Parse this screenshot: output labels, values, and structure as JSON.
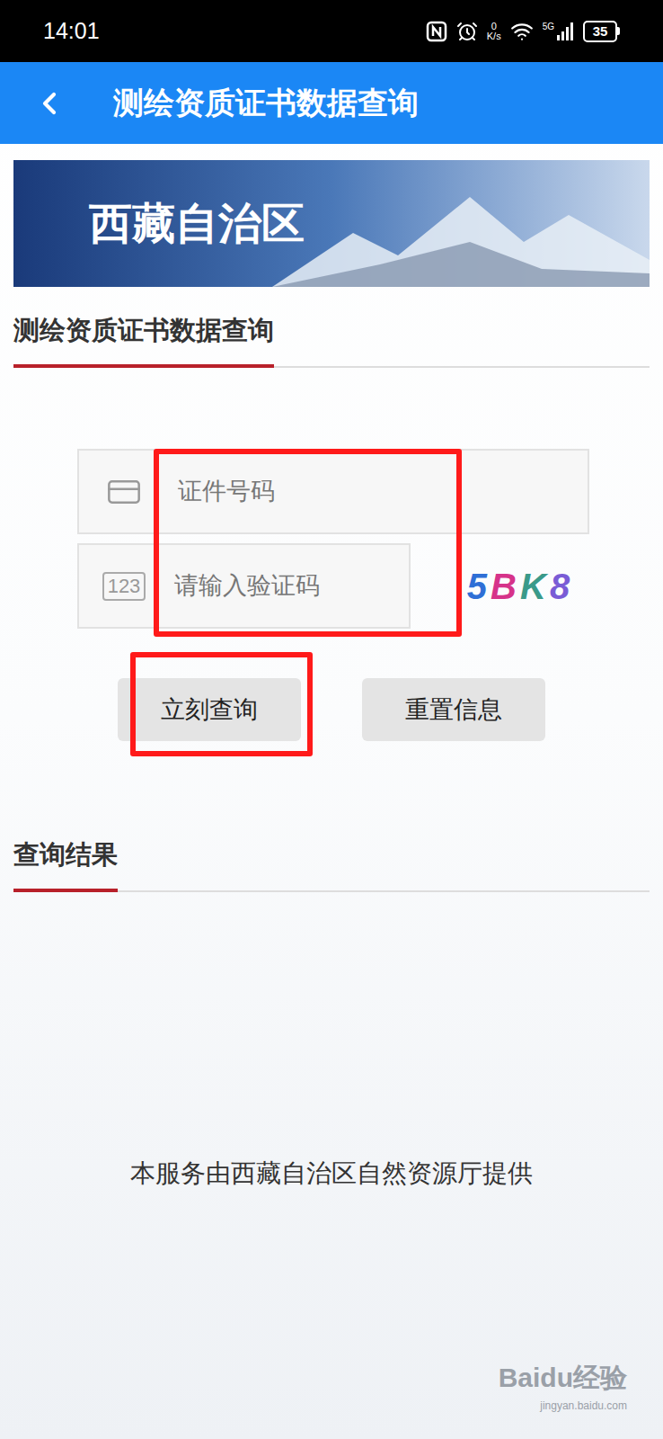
{
  "status_bar": {
    "time": "14:01",
    "speed_value": "0",
    "speed_unit": "K/s",
    "network": "5G",
    "battery": "35"
  },
  "header": {
    "back": "<",
    "title": "测绘资质证书数据查询"
  },
  "banner": {
    "title": "西藏自治区"
  },
  "form_section": {
    "title": "测绘资质证书数据查询"
  },
  "fields": [
    {
      "icon_text": "",
      "placeholder": "证件号码",
      "kind": "id"
    },
    {
      "icon_text": "123",
      "placeholder": "请输入验证码",
      "kind": "captcha"
    }
  ],
  "captcha": {
    "chars": [
      {
        "char": "5",
        "color": "#2f6fd6"
      },
      {
        "char": "B",
        "color": "#d6338a"
      },
      {
        "char": "K",
        "color": "#3a9a8a"
      },
      {
        "char": "8",
        "color": "#7a5cd6"
      }
    ]
  },
  "buttons": [
    {
      "label": "立刻查询",
      "highlighted": true
    },
    {
      "label": "重置信息",
      "highlighted": false
    }
  ],
  "result_section": {
    "title": "查询结果"
  },
  "footer": "本服务由西藏自治区自然资源厅提供",
  "watermark": {
    "brand": "Baidu经验",
    "url": "jingyan.baidu.com"
  }
}
